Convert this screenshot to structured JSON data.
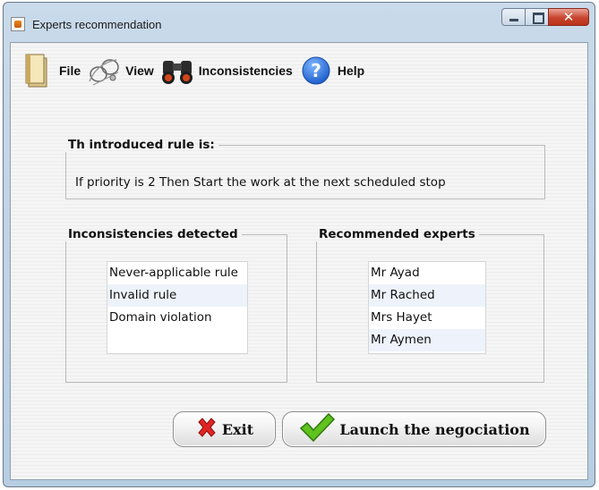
{
  "window": {
    "title": "Experts recommendation"
  },
  "menu": {
    "file": "File",
    "view": "View",
    "inconsistencies": "Inconsistencies",
    "help": "Help"
  },
  "rule_panel": {
    "title": "Th introduced rule is:",
    "text": "If priority is 2 Then Start the work at the next scheduled stop"
  },
  "inconsistencies_panel": {
    "title": "Inconsistencies detected",
    "items": [
      "Never-applicable rule",
      "Invalid rule",
      "Domain violation"
    ]
  },
  "experts_panel": {
    "title": "Recommended experts",
    "items": [
      "Mr Ayad",
      "Mr Rached",
      "Mrs Hayet",
      "Mr Aymen"
    ]
  },
  "buttons": {
    "exit": "Exit",
    "launch": "Launch the negociation"
  },
  "icons": {
    "app": "java-cup-icon",
    "file": "file-icon",
    "view": "view-icon",
    "inconsistencies": "binoculars-icon",
    "help": "help-icon",
    "exit": "red-x-icon",
    "launch": "green-check-icon"
  },
  "colors": {
    "title_bar": "#c9daea",
    "close_button": "#c8452e",
    "list_alt_row": "#eef3fb"
  }
}
